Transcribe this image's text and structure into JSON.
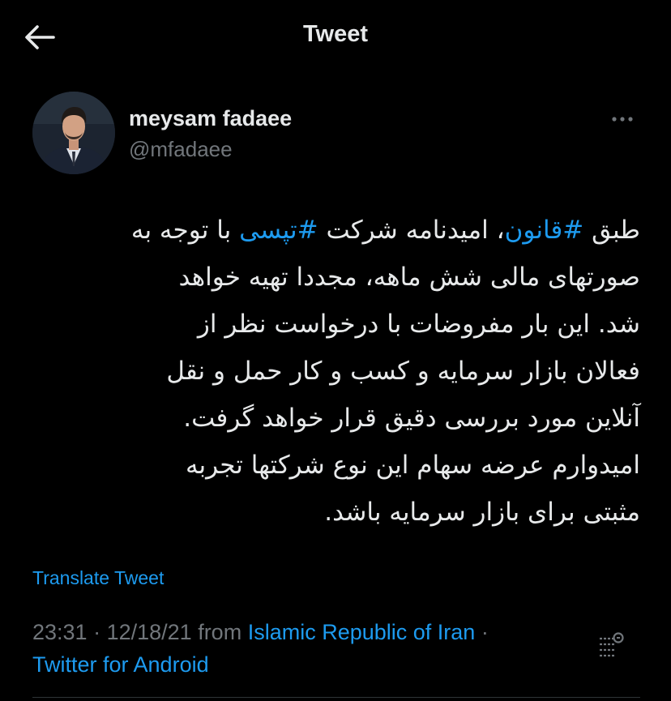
{
  "header": {
    "title": "Tweet",
    "back_icon": "arrow-left-icon"
  },
  "author": {
    "name": "meysam fadaee",
    "handle": "@mfadaee"
  },
  "more_icon": "more-horizontal-icon",
  "tweet": {
    "lines": [
      [
        "طبق ",
        "#قانون",
        "، امیدنامه شرکت ",
        "#تپسی",
        " با توجه به"
      ],
      [
        "صورتهای مالی شش ماهه، مجددا تهیه خواهد"
      ],
      [
        "شد. این بار مفروضات با درخواست نظر از"
      ],
      [
        "فعالان بازار سرمایه و کسب و کار حمل و نقل"
      ],
      [
        "آنلاین مورد بررسی دقیق قرار خواهد گرفت."
      ],
      [
        "امیدوارم عرضه سهام این نوع شرکتها تجربه"
      ],
      [
        "مثبتی برای بازار سرمایه باشد."
      ]
    ],
    "hashtags": [
      "#قانون",
      "#تپسی"
    ]
  },
  "translate_label": "Translate Tweet",
  "meta": {
    "time": "23:31",
    "separator": " · ",
    "date": "12/18/21",
    "from_label": " from ",
    "location": "Islamic Republic of Iran",
    "separator2": " ·",
    "source": "Twitter for Android"
  },
  "analytics_icon": "tweet-analytics-icon",
  "colors": {
    "background": "#000000",
    "text": "#e7e9ea",
    "secondary": "#71767b",
    "accent": "#1d9bf0"
  }
}
